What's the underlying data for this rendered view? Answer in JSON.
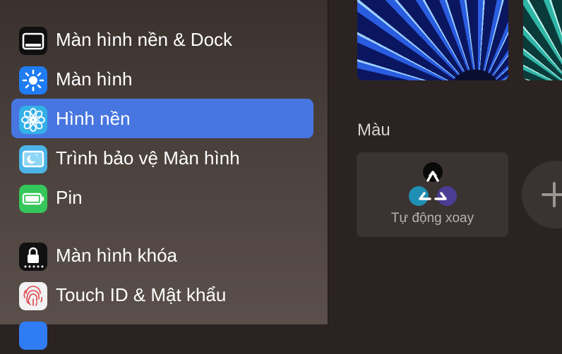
{
  "sidebar": {
    "items": [
      {
        "label": "Màn hình nền & Dock",
        "icon": "desktop-dock-icon"
      },
      {
        "label": "Màn hình",
        "icon": "display-brightness-icon"
      },
      {
        "label": "Hình nền",
        "icon": "wallpaper-flower-icon",
        "selected": true
      },
      {
        "label": "Trình bảo vệ Màn hình",
        "icon": "screen-saver-icon"
      },
      {
        "label": "Pin",
        "icon": "battery-icon"
      },
      {
        "label": "Màn hình khóa",
        "icon": "lock-screen-icon"
      },
      {
        "label": "Touch ID & Mật khẩu",
        "icon": "fingerprint-icon"
      }
    ]
  },
  "main": {
    "section_title": "Màu",
    "auto_rotate_label": "Tự động xoay",
    "add_button_icon": "plus-icon"
  },
  "colors": {
    "selected_bg": "#4776e0",
    "accent_blue": "#2a5ce0",
    "accent_teal": "#2fb5a6"
  }
}
